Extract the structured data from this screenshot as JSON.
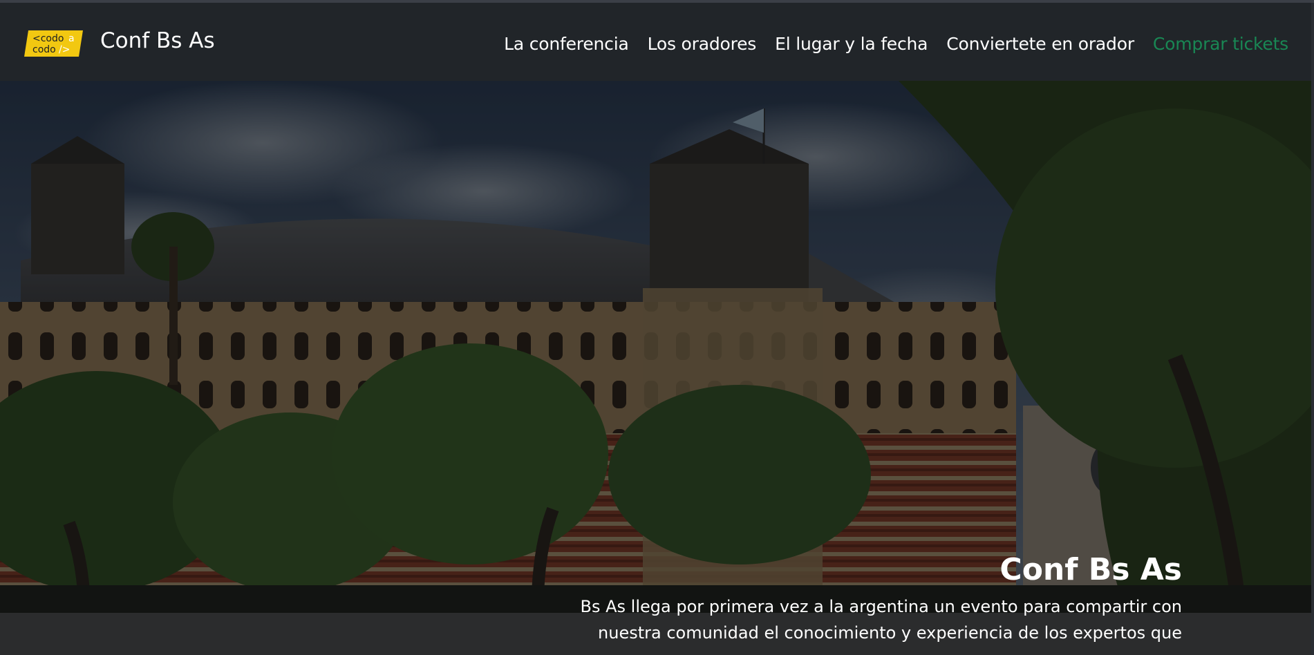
{
  "brand": {
    "logo_line1": "codo",
    "logo_line1_suffix": "a",
    "logo_line2": "codo",
    "logo_line2_suffix": "/>",
    "logo_prefix": "<",
    "title": "Conf Bs As"
  },
  "nav": {
    "items": [
      {
        "label": "La conferencia"
      },
      {
        "label": "Los oradores"
      },
      {
        "label": "El lugar y la fecha"
      },
      {
        "label": "Conviertete en orador"
      },
      {
        "label": "Comprar tickets"
      }
    ]
  },
  "hero": {
    "title": "Conf Bs As",
    "description": "Bs As llega por primera vez a la argentina un evento para compartir con nuestra comunidad el conocimiento y experiencia de los expertos que"
  },
  "colors": {
    "navbar_bg": "#212529",
    "cta": "#198754",
    "logo_yellow": "#f2c811"
  }
}
